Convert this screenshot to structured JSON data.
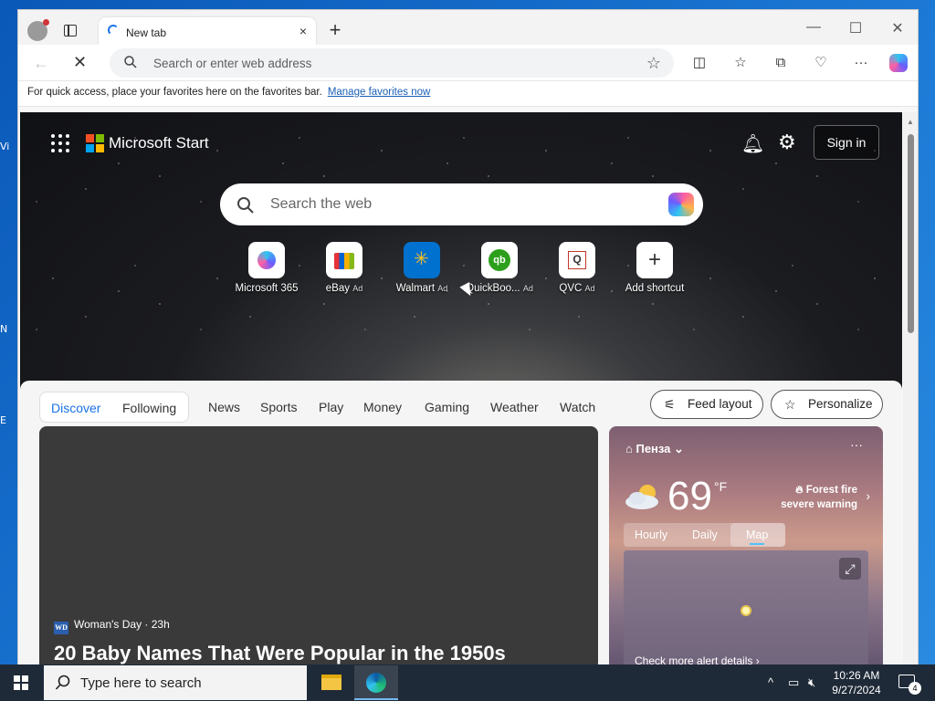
{
  "desktop": {
    "edge_labels": [
      "Vi",
      "N",
      "E"
    ]
  },
  "browser": {
    "tab": {
      "title": "New tab",
      "close_glyph": "×"
    },
    "new_tab_glyph": "+",
    "window_controls": {
      "minimize": "—",
      "maximize": "☐",
      "close": "✕"
    },
    "address_placeholder": "Search or enter web address",
    "favorites_bar": {
      "text": "For quick access, place your favorites here on the favorites bar.",
      "link": "Manage favorites now"
    }
  },
  "ms_start": {
    "brand": "Microsoft Start",
    "sign_in": "Sign in",
    "search_placeholder": "Search the web",
    "shortcuts": [
      {
        "label": "Microsoft 365",
        "ad": "",
        "icon": "microsoft-365-icon"
      },
      {
        "label": "eBay",
        "ad": "Ad",
        "icon": "ebay-icon"
      },
      {
        "label": "Walmart",
        "ad": "Ad",
        "icon": "walmart-icon"
      },
      {
        "label": "QuickBoo...",
        "ad": "Ad",
        "icon": "quickbooks-icon"
      },
      {
        "label": "QVC",
        "ad": "Ad",
        "icon": "qvc-icon"
      },
      {
        "label": "Add shortcut",
        "ad": "",
        "icon": "plus-icon"
      }
    ]
  },
  "feed": {
    "pill_tabs": [
      "Discover",
      "Following"
    ],
    "nav": [
      "News",
      "Sports",
      "Play",
      "Money",
      "Gaming",
      "Weather",
      "Watch"
    ],
    "feed_layout": "Feed layout",
    "personalize": "Personalize",
    "card": {
      "source": "Woman's Day · 23h",
      "source_logo": "WD",
      "headline": "20 Baby Names That Were Popular in the 1950s"
    }
  },
  "weather": {
    "location": "Пенза",
    "temperature": "69",
    "unit": "°F",
    "alert_line1": "Forest fire",
    "alert_line2": "severe warning",
    "tabs": [
      "Hourly",
      "Daily",
      "Map"
    ],
    "selected_tab": "Map",
    "more": "Check more alert details"
  },
  "taskbar": {
    "search_placeholder": "Type here to search",
    "time": "10:26 AM",
    "date": "9/27/2024",
    "notifications": "4"
  },
  "colors": {
    "accent": "#1a5fb4",
    "discover_blue": "#1a73e8",
    "taskbar": "#1f2a38"
  }
}
